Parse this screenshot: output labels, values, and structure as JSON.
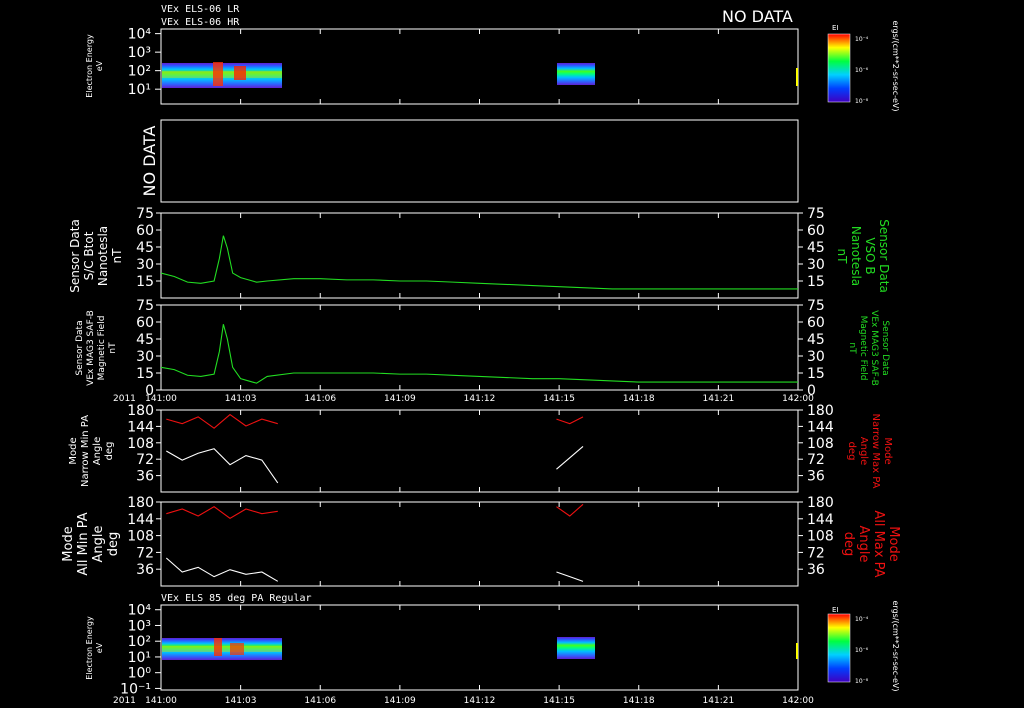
{
  "header": {
    "line1": "VEx ELS-06 LR",
    "line2": "VEx ELS-06 HR",
    "no_data": "NO DATA"
  },
  "colors": {
    "white": "#ffffff",
    "green": "#22dd22",
    "red": "#ee1111",
    "background": "#000000"
  },
  "colorbar": {
    "label": "EI",
    "units": "ergs/(cm**2-sr-sec-eV)",
    "ticks": [
      "10⁻⁴",
      "10⁻⁶",
      "10⁻⁸"
    ],
    "ticks_bottom": [
      "10⁻⁴",
      "10⁻⁶",
      "10⁻⁸"
    ]
  },
  "panels": {
    "p1": {
      "ylabel": [
        "Electron Energy",
        "eV"
      ],
      "yticks": [
        "10⁴",
        "10³",
        "10²",
        "10¹"
      ]
    },
    "p2": {
      "ylabel": "NO DATA"
    },
    "p3": {
      "ylabel": [
        "Sensor Data",
        "S/C Btot",
        "Nanotesla",
        "nT"
      ],
      "ylabel_right": [
        "Sensor Data",
        "VSO B",
        "Nanotesla",
        "nT"
      ],
      "yticks": [
        "75",
        "60",
        "45",
        "30",
        "15"
      ]
    },
    "p4": {
      "ylabel": [
        "Sensor Data",
        "VEx MAG3 SAF-B",
        "Magnetic Field",
        "nT"
      ],
      "ylabel_right": [
        "Sensor Data",
        "VEx MAG3 SAF-B",
        "Magnetic Field",
        "nT"
      ],
      "yticks": [
        "75",
        "60",
        "45",
        "30",
        "15",
        "0"
      ]
    },
    "p5": {
      "ylabel": [
        "Mode",
        "Narrow Min PA",
        "Angle",
        "deg"
      ],
      "ylabel_right": [
        "Mode",
        "Narrow Max PA",
        "Angle",
        "deg"
      ],
      "yticks": [
        "180",
        "144",
        "108",
        "72",
        "36"
      ]
    },
    "p6": {
      "ylabel": [
        "Mode",
        "All Min PA",
        "Angle",
        "deg"
      ],
      "ylabel_right": [
        "Mode",
        "All Max PA",
        "Angle",
        "deg"
      ],
      "yticks": [
        "180",
        "144",
        "108",
        "72",
        "36"
      ]
    },
    "p7": {
      "title": "VEx ELS 85 deg PA Regular",
      "ylabel": [
        "Electron Energy",
        "eV"
      ],
      "yticks": [
        "10⁴",
        "10³",
        "10²",
        "10¹",
        "10⁰",
        "10⁻¹"
      ]
    }
  },
  "time_axis": {
    "year": "2011",
    "ticks": [
      "141:00",
      "141:03",
      "141:06",
      "141:09",
      "141:12",
      "141:15",
      "141:18",
      "141:21",
      "142:00"
    ]
  },
  "chart_data": [
    {
      "type": "heatmap",
      "panel": "p1",
      "x_unit": "time (day 141, hh:mm)",
      "y_unit": "eV (log)",
      "ylim": [
        1,
        10000
      ],
      "data_intervals": [
        [
          "141:00",
          "141:04.6"
        ],
        [
          "141:14.8",
          "141:16.2"
        ]
      ],
      "peak_band_eV": [
        10,
        100
      ]
    },
    {
      "type": "line",
      "panel": "p3",
      "ylabel": "S/C Btot nT",
      "ylim": [
        0,
        75
      ],
      "series": [
        {
          "name": "VSO B",
          "color": "#22dd22",
          "x": [
            0.0,
            0.5,
            1.0,
            1.5,
            2.0,
            2.2,
            2.35,
            2.5,
            2.7,
            3.0,
            3.3,
            3.6,
            4.0,
            5.0,
            6.0,
            7.0,
            8.0,
            9.0,
            10.0,
            11.0,
            12.0,
            13.0,
            14.0,
            15.0,
            16.0,
            17.0,
            18.0,
            19.0,
            20.0,
            21.0,
            22.0,
            23.0,
            24.0
          ],
          "y": [
            22,
            19,
            14,
            13,
            15,
            35,
            55,
            44,
            22,
            18,
            16,
            14,
            15,
            17,
            17,
            16,
            16,
            15,
            15,
            14,
            13,
            12,
            11,
            10,
            9,
            8,
            8,
            8,
            8,
            8,
            8,
            8,
            8
          ]
        }
      ]
    },
    {
      "type": "line",
      "panel": "p4",
      "ylabel": "Magnetic Field nT",
      "ylim": [
        0,
        75
      ],
      "series": [
        {
          "name": "VEx MAG3 SAF-B",
          "color": "#22dd22",
          "x": [
            0.0,
            0.5,
            1.0,
            1.5,
            2.0,
            2.2,
            2.35,
            2.5,
            2.7,
            3.0,
            3.3,
            3.6,
            4.0,
            5.0,
            6.0,
            7.0,
            8.0,
            9.0,
            10.0,
            11.0,
            12.0,
            13.0,
            14.0,
            15.0,
            16.0,
            17.0,
            18.0,
            19.0,
            20.0,
            21.0,
            22.0,
            23.0,
            24.0
          ],
          "y": [
            20,
            18,
            13,
            12,
            14,
            34,
            58,
            45,
            20,
            10,
            8,
            6,
            12,
            15,
            15,
            15,
            15,
            14,
            14,
            13,
            12,
            11,
            10,
            10,
            9,
            8,
            7,
            7,
            7,
            7,
            7,
            7,
            7
          ]
        }
      ]
    },
    {
      "type": "line",
      "panel": "p5",
      "ylim": [
        0,
        180
      ],
      "series": [
        {
          "name": "Narrow Max PA",
          "color": "#ee1111",
          "x": [
            0.2,
            0.8,
            1.4,
            2.0,
            2.6,
            3.2,
            3.8,
            4.4,
            14.9,
            15.4,
            15.9
          ],
          "y": [
            160,
            150,
            165,
            140,
            170,
            145,
            160,
            150,
            160,
            150,
            165
          ]
        },
        {
          "name": "Narrow Min PA",
          "color": "#ffffff",
          "x": [
            0.2,
            0.8,
            1.4,
            2.0,
            2.6,
            3.2,
            3.8,
            4.4,
            14.9,
            15.4,
            15.9
          ],
          "y": [
            90,
            70,
            85,
            95,
            60,
            80,
            70,
            20,
            50,
            75,
            100
          ]
        }
      ]
    },
    {
      "type": "line",
      "panel": "p6",
      "ylim": [
        0,
        180
      ],
      "series": [
        {
          "name": "All Max PA",
          "color": "#ee1111",
          "x": [
            0.2,
            0.8,
            1.4,
            2.0,
            2.6,
            3.2,
            3.8,
            4.4,
            14.9,
            15.4,
            15.9
          ],
          "y": [
            155,
            165,
            150,
            170,
            145,
            165,
            155,
            160,
            170,
            150,
            175
          ]
        },
        {
          "name": "All Min PA",
          "color": "#ffffff",
          "x": [
            0.2,
            0.8,
            1.4,
            2.0,
            2.6,
            3.2,
            3.8,
            4.4,
            14.9,
            15.4,
            15.9
          ],
          "y": [
            60,
            30,
            40,
            20,
            35,
            25,
            30,
            10,
            30,
            20,
            10
          ]
        }
      ]
    },
    {
      "type": "heatmap",
      "panel": "p7",
      "x_unit": "time (day 141, hh:mm)",
      "y_unit": "eV (log)",
      "ylim": [
        0.1,
        10000
      ],
      "data_intervals": [
        [
          "141:00",
          "141:04.6"
        ],
        [
          "141:14.8",
          "141:16.2"
        ]
      ],
      "peak_band_eV": [
        10,
        100
      ]
    }
  ]
}
